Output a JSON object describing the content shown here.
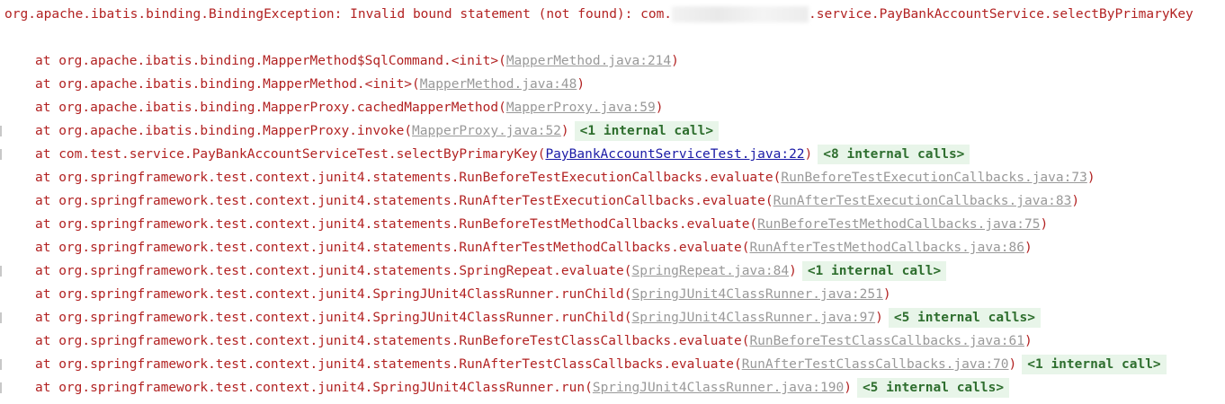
{
  "header": {
    "prefix": "org.apache.ibatis.binding.BindingException: Invalid bound statement (not found): com.",
    "suffix": ".service.PayBankAccountService.selectByPrimaryKey"
  },
  "frames": [
    {
      "at": "at ",
      "method": "org.apache.ibatis.binding.MapperMethod$SqlCommand.<init>",
      "link": "MapperMethod.java:214",
      "badge": ""
    },
    {
      "at": "at ",
      "method": "org.apache.ibatis.binding.MapperMethod.<init>",
      "link": "MapperMethod.java:48",
      "badge": ""
    },
    {
      "at": "at ",
      "method": "org.apache.ibatis.binding.MapperProxy.cachedMapperMethod",
      "link": "MapperProxy.java:59",
      "badge": ""
    },
    {
      "at": "at ",
      "method": "org.apache.ibatis.binding.MapperProxy.invoke",
      "link": "MapperProxy.java:52",
      "badge": "<1 internal call>"
    },
    {
      "at": "at ",
      "method": "com.test.service.PayBankAccountServiceTest.selectByPrimaryKey",
      "link": "PayBankAccountServiceTest.java:22",
      "badge": "<8 internal calls>"
    },
    {
      "at": "at ",
      "method": "org.springframework.test.context.junit4.statements.RunBeforeTestExecutionCallbacks.evaluate",
      "link": "RunBeforeTestExecutionCallbacks.java:73",
      "badge": ""
    },
    {
      "at": "at ",
      "method": "org.springframework.test.context.junit4.statements.RunAfterTestExecutionCallbacks.evaluate",
      "link": "RunAfterTestExecutionCallbacks.java:83",
      "badge": ""
    },
    {
      "at": "at ",
      "method": "org.springframework.test.context.junit4.statements.RunBeforeTestMethodCallbacks.evaluate",
      "link": "RunBeforeTestMethodCallbacks.java:75",
      "badge": ""
    },
    {
      "at": "at ",
      "method": "org.springframework.test.context.junit4.statements.RunAfterTestMethodCallbacks.evaluate",
      "link": "RunAfterTestMethodCallbacks.java:86",
      "badge": ""
    },
    {
      "at": "at ",
      "method": "org.springframework.test.context.junit4.statements.SpringRepeat.evaluate",
      "link": "SpringRepeat.java:84",
      "badge": "<1 internal call>"
    },
    {
      "at": "at ",
      "method": "org.springframework.test.context.junit4.SpringJUnit4ClassRunner.runChild",
      "link": "SpringJUnit4ClassRunner.java:251",
      "badge": ""
    },
    {
      "at": "at ",
      "method": "org.springframework.test.context.junit4.SpringJUnit4ClassRunner.runChild",
      "link": "SpringJUnit4ClassRunner.java:97",
      "badge": "<5 internal calls>"
    },
    {
      "at": "at ",
      "method": "org.springframework.test.context.junit4.statements.RunBeforeTestClassCallbacks.evaluate",
      "link": "RunBeforeTestClassCallbacks.java:61",
      "badge": ""
    },
    {
      "at": "at ",
      "method": "org.springframework.test.context.junit4.statements.RunAfterTestClassCallbacks.evaluate",
      "link": "RunAfterTestClassCallbacks.java:70",
      "badge": "<1 internal call>"
    },
    {
      "at": "at ",
      "method": "org.springframework.test.context.junit4.SpringJUnit4ClassRunner.run",
      "link": "SpringJUnit4ClassRunner.java:190",
      "badge": "<5 internal calls>"
    }
  ],
  "paren_open": "(",
  "paren_close": ")"
}
